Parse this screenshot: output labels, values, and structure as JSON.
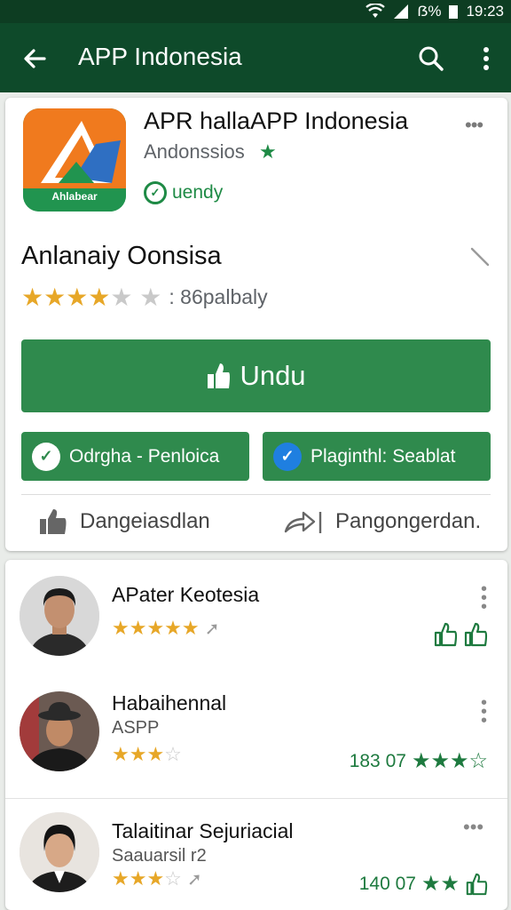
{
  "status_bar": {
    "battery": "ẞ%",
    "time": "19:23"
  },
  "app_bar": {
    "title": "APP Indonesia",
    "back_icon": "arrow-back-icon",
    "search_icon": "search-icon",
    "more_icon": "more-vert-icon"
  },
  "app": {
    "icon_word": "Ahlabear",
    "name": "APR hallaAPP Indonesia",
    "developer": "Andonssios",
    "badge": "uendy",
    "subtitle": "Anlanaiy Oonsisa",
    "rating_stars": 3.5,
    "rating_text": ": 86palbaly",
    "install_label": "Undu",
    "pill_left": "Odrgha - Penloica",
    "pill_right": "Plaginthl: Seablat",
    "action_left": "Dangeiasdlan",
    "action_right": "Pangongerdan."
  },
  "reviews": [
    {
      "name": "APater Keotesia",
      "sub": "",
      "stars": 4.5,
      "count": ""
    },
    {
      "name": "Habaihennal",
      "sub": "ASPP",
      "stars": 2.5,
      "count": "183 07"
    },
    {
      "name": "Talaitinar Sejuriacial",
      "sub": "Saauarsil r2",
      "stars": 3,
      "count": "140 07"
    }
  ],
  "colors": {
    "app_bar": "#0e4a2a",
    "primary_green": "#2f8a4d",
    "star": "#e7a728"
  }
}
